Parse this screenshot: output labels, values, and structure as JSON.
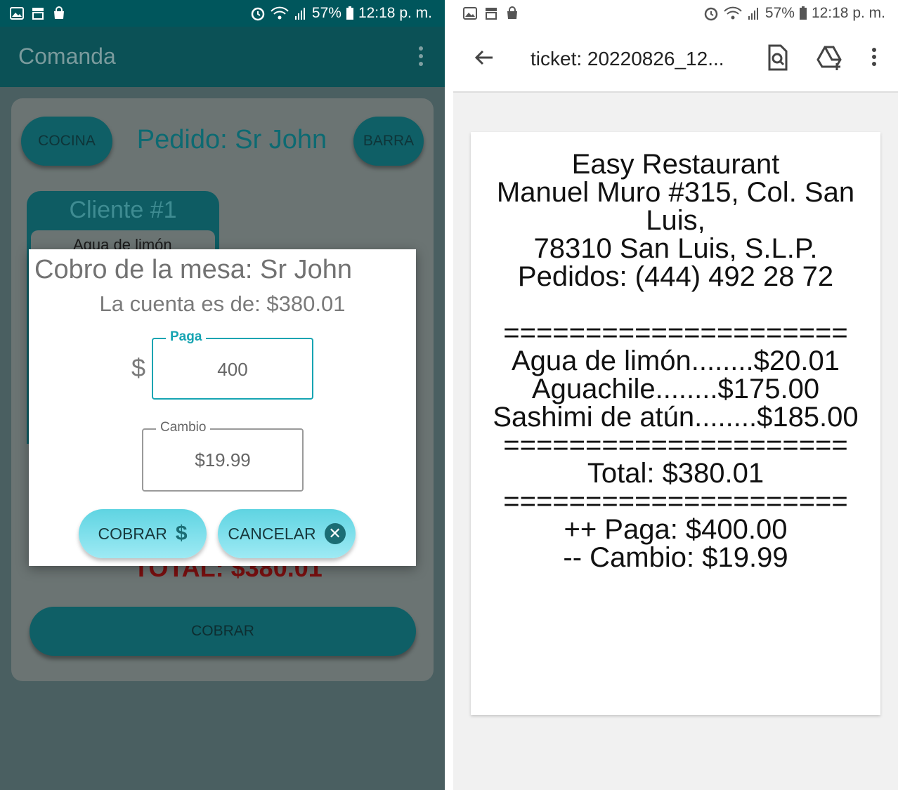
{
  "left": {
    "status": {
      "battery": "57%",
      "time": "12:18 p. m."
    },
    "appbar": {
      "title": "Comanda"
    },
    "buttons": {
      "cocina": "COCINA",
      "barra": "BARRA",
      "cobrar": "COBRAR"
    },
    "order_title": "Pedido: Sr John",
    "client": {
      "title": "Cliente #1",
      "item": "Agua de limón"
    },
    "total_behind": "TOTAL: $380.01",
    "dialog": {
      "title": "Cobro de la mesa: Sr John",
      "amount": "La cuenta es de: $380.01",
      "currency_symbol": "$",
      "pay_label": "Paga",
      "pay_value": "400",
      "change_label": "Cambio",
      "change_value": "$19.99",
      "cobrar_label": "COBRAR",
      "cancel_label": "CANCELAR"
    }
  },
  "right": {
    "status": {
      "battery": "57%",
      "time": "12:18 p. m."
    },
    "toolbar": {
      "title": "ticket: 20220826_12..."
    },
    "ticket_lines": [
      "Easy Restaurant",
      "Manuel Muro #315, Col. San",
      "Luis,",
      "78310 San Luis, S.L.P.",
      "Pedidos: (444) 492 28 72",
      "",
      "=====================",
      "Agua de limón........$20.01",
      "Aguachile........$175.00",
      "Sashimi de atún........$185.00",
      "=====================",
      "Total: $380.01",
      "=====================",
      "++ Paga: $400.00",
      "-- Cambio: $19.99"
    ]
  },
  "icons": {
    "status_left": [
      "image-icon",
      "store-icon",
      "shopping-bag-icon"
    ],
    "status_right": [
      "alarm-icon",
      "wifi-icon",
      "signal-icon",
      "battery-icon"
    ],
    "toolbar": [
      "back-arrow-icon",
      "find-in-page-icon",
      "drive-add-icon",
      "more-vert-icon"
    ]
  },
  "colors": {
    "teal_dark": "#0b5156",
    "accent": "#16a4b2",
    "button_gradient": "#5fd4e2",
    "total_red": "#7a0f0f"
  }
}
